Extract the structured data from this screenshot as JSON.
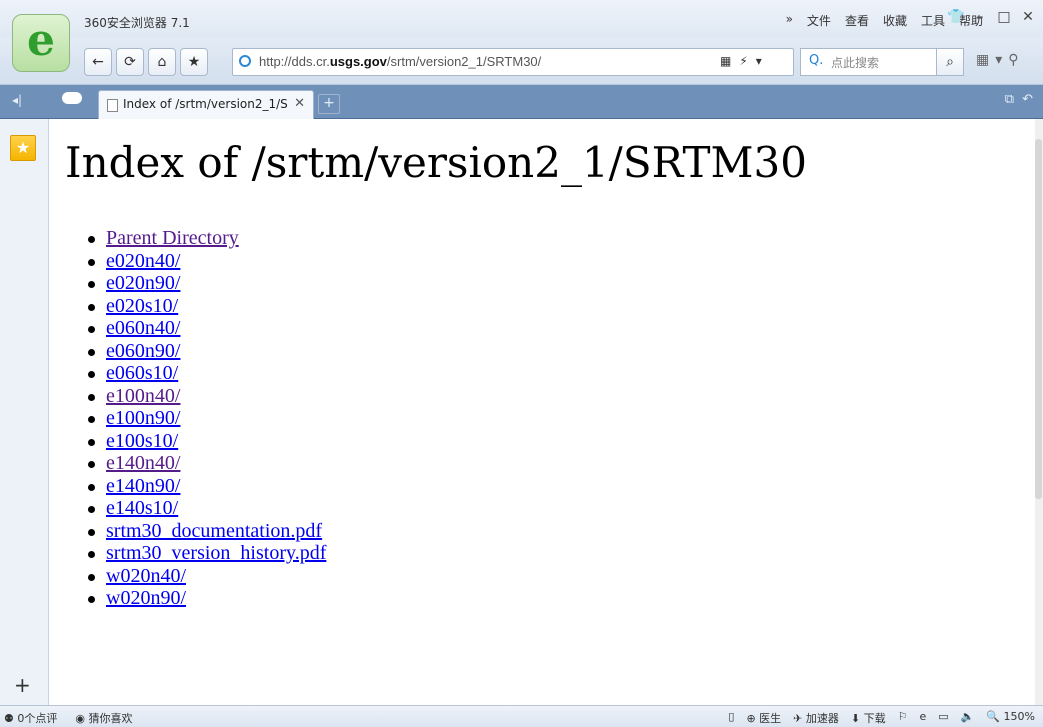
{
  "browser": {
    "app_title": "360安全浏览器 7.1",
    "menu": [
      "»",
      "文件",
      "查看",
      "收藏",
      "工具",
      "帮助"
    ],
    "window_buttons": [
      "👕",
      "–",
      "□",
      "✕"
    ],
    "url_prefix": "http://dds.cr.",
    "url_domain": "usgs.gov",
    "url_path": "/srtm/version2_1/SRTM30/",
    "search_placeholder": "点此搜索",
    "search_engine_mark": "Q.",
    "nav_buttons": {
      "back": "←",
      "refresh": "⟳",
      "home": "⌂",
      "favorite": "★"
    },
    "address_tools": [
      "▦",
      "⚡",
      "▾"
    ],
    "ext_icons": [
      "▦",
      "▾",
      "⚲"
    ],
    "tab": {
      "title": "Index of /srtm/version2_1/S",
      "close": "✕"
    },
    "newtab": "+",
    "tabbar_left": "◂|",
    "tabbar_right": [
      "⧉",
      "↶"
    ],
    "sidebar_plus": "+"
  },
  "page": {
    "heading": "Index of /srtm/version2_1/SRTM30",
    "entries": [
      {
        "name": "Parent Directory",
        "visited": true
      },
      {
        "name": "e020n40/",
        "visited": false
      },
      {
        "name": "e020n90/",
        "visited": false
      },
      {
        "name": "e020s10/",
        "visited": false
      },
      {
        "name": "e060n40/",
        "visited": false
      },
      {
        "name": "e060n90/",
        "visited": false
      },
      {
        "name": "e060s10/",
        "visited": false
      },
      {
        "name": "e100n40/",
        "visited": true
      },
      {
        "name": "e100n90/",
        "visited": false
      },
      {
        "name": "e100s10/",
        "visited": false
      },
      {
        "name": "e140n40/",
        "visited": true
      },
      {
        "name": "e140n90/",
        "visited": false
      },
      {
        "name": "e140s10/",
        "visited": false
      },
      {
        "name": "srtm30_documentation.pdf",
        "visited": false
      },
      {
        "name": "srtm30_version_history.pdf",
        "visited": false
      },
      {
        "name": "w020n40/",
        "visited": false
      },
      {
        "name": "w020n90/",
        "visited": false
      }
    ]
  },
  "status": {
    "left": [
      "⚉ 0个点评",
      "◉ 猜你喜欢"
    ],
    "right": [
      "▯",
      "⊕ 医生",
      "✈ 加速器",
      "⬇ 下载",
      "⚐",
      "e",
      "▭",
      "🔈",
      "🔍 150%"
    ]
  }
}
